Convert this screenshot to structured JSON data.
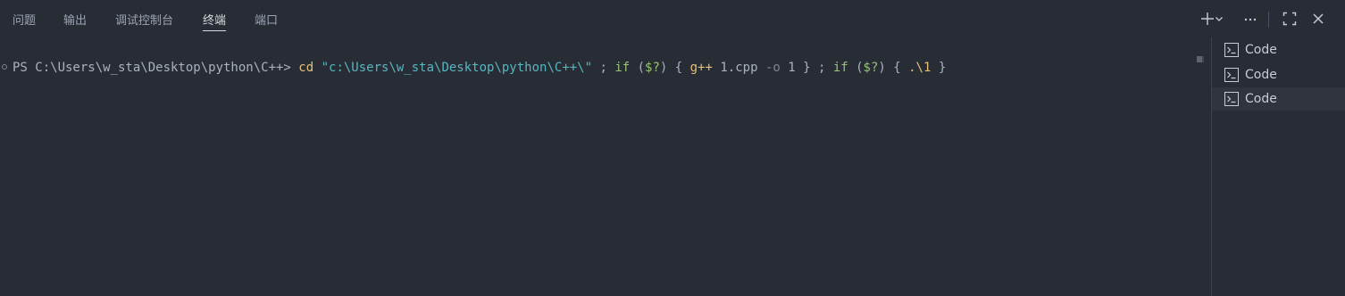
{
  "tabs": [
    {
      "label": "问题"
    },
    {
      "label": "输出"
    },
    {
      "label": "调试控制台"
    },
    {
      "label": "终端"
    },
    {
      "label": "端口"
    }
  ],
  "active_tab": "终端",
  "actions": {
    "new_terminal_icon": "plus-icon",
    "dropdown_icon": "chevron-down-icon",
    "more_icon": "ellipsis-icon",
    "maximize_icon": "maximize-icon",
    "close_icon": "close-icon"
  },
  "terminal": {
    "prompt": "PS C:\\Users\\w_sta\\Desktop\\python\\C++> ",
    "tokens": [
      {
        "text": "cd",
        "kind": "cd"
      },
      {
        "text": " ",
        "kind": "plain"
      },
      {
        "text": "\"c:\\Users\\w_sta\\Desktop\\python\\C++\\\"",
        "kind": "str"
      },
      {
        "text": " ; ",
        "kind": "plain"
      },
      {
        "text": "if",
        "kind": "kw"
      },
      {
        "text": " (",
        "kind": "plain"
      },
      {
        "text": "$?",
        "kind": "var"
      },
      {
        "text": ") { ",
        "kind": "plain"
      },
      {
        "text": "g++",
        "kind": "cmd"
      },
      {
        "text": " 1.cpp ",
        "kind": "arg"
      },
      {
        "text": "-o",
        "kind": "flag"
      },
      {
        "text": " 1 } ; ",
        "kind": "arg"
      },
      {
        "text": "if",
        "kind": "kw"
      },
      {
        "text": " (",
        "kind": "plain"
      },
      {
        "text": "$?",
        "kind": "var"
      },
      {
        "text": ") { ",
        "kind": "plain"
      },
      {
        "text": ".\\1",
        "kind": "cmd"
      },
      {
        "text": " }",
        "kind": "plain"
      }
    ]
  },
  "terminal_list": [
    {
      "label": "Code",
      "icon": "terminal-icon",
      "selected": false
    },
    {
      "label": "Code",
      "icon": "terminal-icon",
      "selected": false
    },
    {
      "label": "Code",
      "icon": "terminal-icon",
      "selected": true
    }
  ]
}
